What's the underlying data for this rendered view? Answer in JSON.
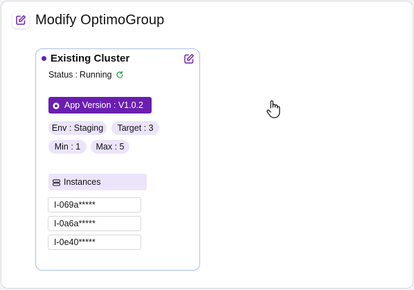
{
  "header": {
    "title": "Modify OptimoGroup",
    "icon": "edit-icon",
    "accent": "#6a1fb0"
  },
  "card": {
    "title": "Existing Cluster",
    "status_label": "Status",
    "status_separator": ":",
    "status_value": "Running",
    "status_icon": "refresh-icon",
    "status_color": "#2ea44f",
    "app_version": "App Version : V1.0.2",
    "env": "Env : Staging",
    "target": "Target : 3",
    "min": "Min : 1",
    "max": "Max : 5",
    "instances_label": "Instances",
    "instances": [
      "I-069a*****",
      "I-0a6a*****",
      "I-0e40*****"
    ]
  },
  "cursor": "hand-pointer-icon"
}
